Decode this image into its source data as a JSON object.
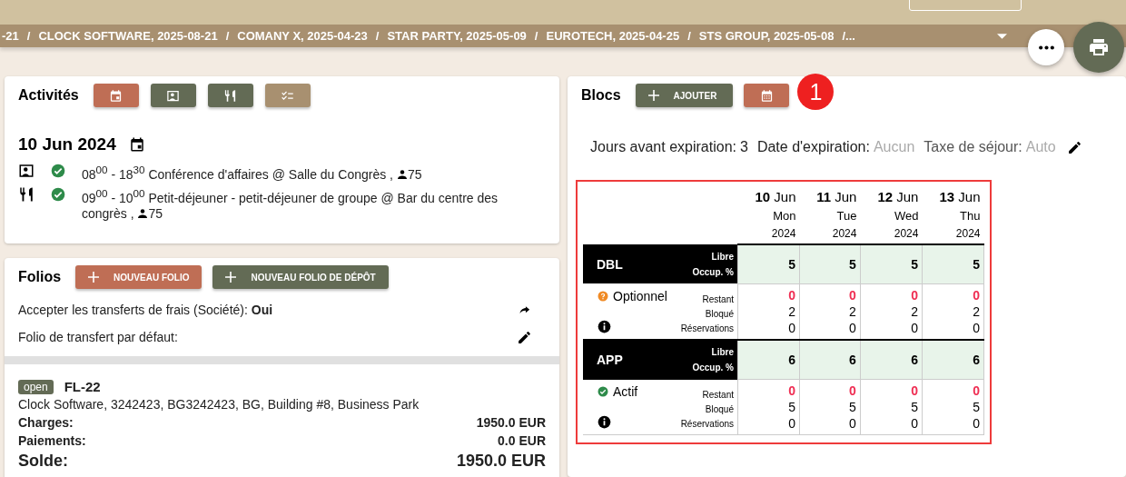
{
  "breadcrumb": {
    "items": [
      "-21",
      "CLOCK SOFTWARE, 2025-08-21",
      "COMANY X, 2025-04-23",
      "STAR PARTY, 2025-05-09",
      "EUROTECH, 2025-04-25",
      "STS GROUP, 2025-05-08"
    ],
    "separator": "/",
    "overflow": "/..."
  },
  "activities": {
    "title": "Activités",
    "buttons": [
      {
        "kind": "calendar",
        "selected": true
      },
      {
        "kind": "conference",
        "selected": false
      },
      {
        "kind": "meal",
        "selected": false
      },
      {
        "kind": "checklist",
        "selected": false
      }
    ],
    "date": "10 Jun 2024",
    "events": [
      {
        "kind": "conference",
        "confirmed": true,
        "text": "08$^{00}$ - 18$^{30}$ Conférence d'affaires @ Salle du Congrès ,",
        "guests": "75"
      },
      {
        "kind": "meal",
        "confirmed": true,
        "text": "09$^{00}$ - 10$^{00}$ Petit-déjeuner - petit-déjeuner de groupe @ Bar du centre des congrès ,",
        "guests": "75"
      }
    ]
  },
  "folios": {
    "title": "Folios",
    "buttons": [
      {
        "label": "NOUVEAU FOLIO",
        "kind": "primary"
      },
      {
        "label": "NOUVEAU FOLIO DE DÉPÔT",
        "kind": "secondary"
      }
    ],
    "settings": [
      {
        "text": "Accepter les transferts de frais (Société): **Oui**",
        "kind": "forward"
      },
      {
        "text": "Folio de transfert par défaut:",
        "kind": "edit"
      }
    ],
    "folio": {
      "status": "open",
      "number": "FL-22",
      "address": "Clock Software, 3242423, BG3242423, BG, Building #8, Business Park",
      "lines": [
        {
          "label": "Charges:",
          "value": "1950.0 EUR"
        },
        {
          "label": "Paiements:",
          "value": "0.0 EUR"
        },
        {
          "label": "Solde:",
          "value": "1950.0 EUR",
          "kind": "total"
        }
      ]
    }
  },
  "blocs": {
    "title": "Blocs",
    "add_button": "AJOUTER",
    "badge": "1",
    "info": {
      "days_label": "Jours avant expiration:",
      "days_value": "3",
      "date_label": "Date d'expiration:",
      "date_value": "Aucun",
      "tax_label": "Taxe de séjour:",
      "tax_value": "Auto"
    },
    "days": [
      {
        "day": "10",
        "month": "Jun",
        "weekday": "Mon",
        "year": "2024"
      },
      {
        "day": "11",
        "month": "Jun",
        "weekday": "Tue",
        "year": "2024"
      },
      {
        "day": "12",
        "month": "Jun",
        "weekday": "Wed",
        "year": "2024"
      },
      {
        "day": "13",
        "month": "Jun",
        "weekday": "Thu",
        "year": "2024"
      }
    ],
    "rooms": [
      {
        "type": "DBL",
        "free_label": "Libre",
        "occ_label": "Occup. %",
        "free": [
          "5",
          "5",
          "5",
          "5"
        ],
        "status": {
          "label": "Optionnel",
          "kind": "optional"
        },
        "row_labels": [
          "Restant",
          "Bloqué",
          "Réservations"
        ],
        "remaining": [
          "0",
          "0",
          "0",
          "0"
        ],
        "blocked": [
          "2",
          "2",
          "2",
          "2"
        ],
        "reservations": [
          "0",
          "0",
          "0",
          "0"
        ]
      },
      {
        "type": "APP",
        "free_label": "Libre",
        "occ_label": "Occup. %",
        "free": [
          "6",
          "6",
          "6",
          "6"
        ],
        "status": {
          "label": "Actif",
          "kind": "active"
        },
        "row_labels": [
          "Restant",
          "Bloqué",
          "Réservations"
        ],
        "remaining": [
          "0",
          "0",
          "0",
          "0"
        ],
        "blocked": [
          "5",
          "5",
          "5",
          "5"
        ],
        "reservations": [
          "0",
          "0",
          "0",
          "0"
        ]
      }
    ]
  }
}
